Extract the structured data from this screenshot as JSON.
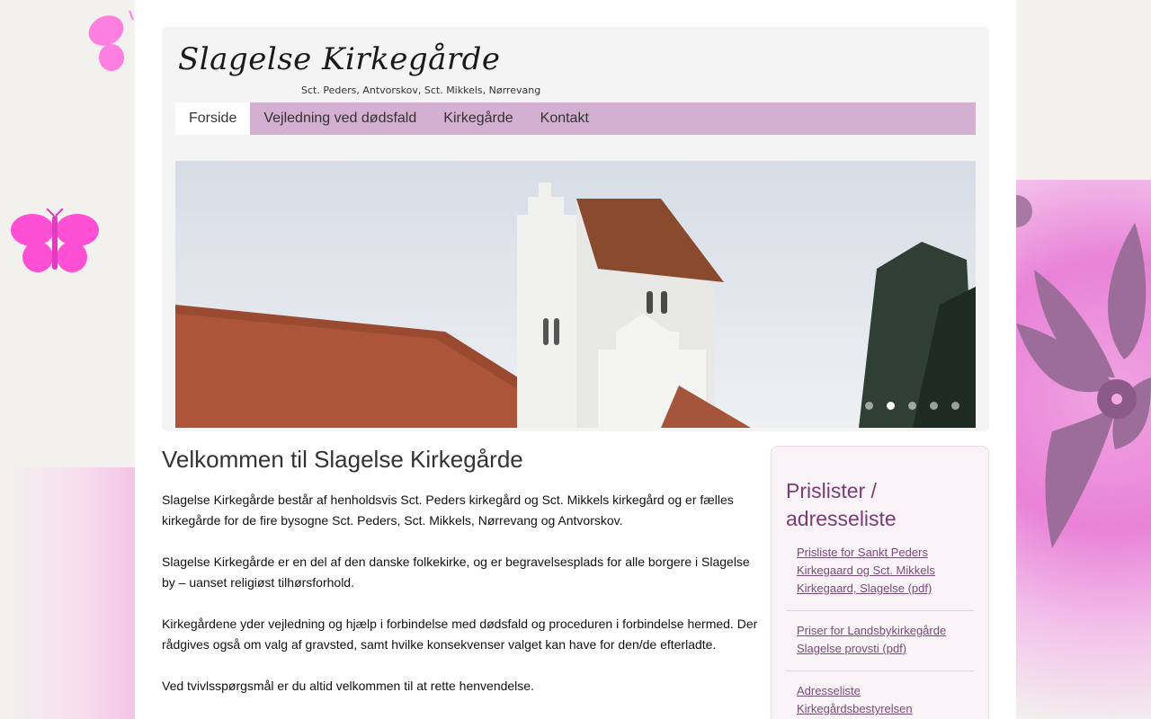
{
  "header": {
    "logo_title": "Slagelse Kirkegårde",
    "logo_subtitle": "Sct. Peders, Antvorskov, Sct. Mikkels, Nørrevang"
  },
  "nav": {
    "items": [
      {
        "label": "Forside",
        "active": true
      },
      {
        "label": "Vejledning ved dødsfald",
        "active": false
      },
      {
        "label": "Kirkegårde",
        "active": false
      },
      {
        "label": "Kontakt",
        "active": false
      }
    ]
  },
  "slider": {
    "slide_count": 5,
    "active_slide": 2
  },
  "content": {
    "heading": "Velkommen til Slagelse Kirkegårde",
    "paragraphs": [
      "Slagelse Kirkegårde består af henholdsvis Sct. Peders kirkegård og Sct. Mikkels kirkegård og er fælles kirkegårde for de fire bysogne Sct. Peders, Sct. Mikkels, Nørrevang og Antvorskov.",
      "Slagelse Kirkegårde er en del af den danske folkekirke, og er begravelsesplads for alle borgere i Slagelse by – uanset religiøst tilhørsforhold.",
      "Kirkegårdene yder vejledning og hjælp i forbindelse med dødsfald og proceduren i forbindelse hermed. Der rådgives også om valg af gravsted, samt hvilke konsekvenser valget kan have for den/de efterladte.",
      "Ved tvivlsspørgsmål er du altid velkommen til at rette henvendelse."
    ]
  },
  "sidebar": {
    "heading": "Prislister / adresseliste",
    "links": [
      "Prisliste for Sankt Peders Kirkegaard og Sct. Mikkels Kirkegaard, Slagelse (pdf)",
      "Priser for Landsbykirkegårde Slagelse provsti (pdf)",
      "Adresseliste Kirkegårdsbestyrelsen"
    ]
  },
  "colors": {
    "nav_bg": "#d3b0d1",
    "sidebar_heading": "#7a3c76",
    "link": "#7a4a78",
    "butterfly": "#ff5fd6"
  }
}
